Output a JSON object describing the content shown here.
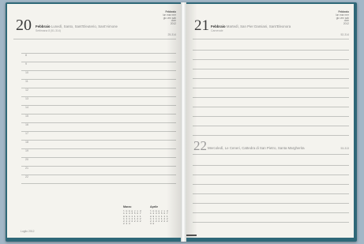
{
  "left_page": {
    "day_number": "20",
    "day_name": "Febbraio",
    "day_subtitle": "Lunedì, Santo, Sant'Eleuterio, Sant'Aimone",
    "day_line2": "Settimana 8 (51-314)",
    "mini_calendar": [
      "Febbraio",
      "lun mar mer",
      "gio ven sab",
      "dom",
      "2012"
    ],
    "corner_text": "25-314",
    "hours": [
      "8",
      "9",
      "10",
      "11",
      "12",
      "13",
      "14",
      "15",
      "16",
      "17",
      "18",
      "19",
      "20",
      "21",
      "22"
    ],
    "footer_text": "Luglio 2012",
    "cal1_head": "Marzo",
    "cal2_head": "Aprile",
    "cal1_body": "l m m g v s d\n1 2 3 4 5 6 7\n8 9 1 1 1 1 1\n1 1 1 1 1 2 2\n2 2 2 2 2 2 2\n2 3 3",
    "cal2_body": "l m m g v s d\n1 2 3 4 5 6 7\n8 9 1 1 1 1 1\n1 1 1 1 1 2 2\n2 2 2 2 2 2 2\n3 0"
  },
  "right_page": {
    "day_number": "21",
    "day_name": "Febbraio",
    "day_subtitle": "Martedì, San Pier Damiani, Sant'Eleonora",
    "day_line2": "Carnevale",
    "mini_calendar": [
      "Febbraio",
      "lun mar mer",
      "gio ven sab",
      "dom",
      "2012"
    ],
    "corner_text": "52-314",
    "day2_number": "22",
    "day2_subtitle": "Mercoledì, Le Ceneri, Cattedra di San Pietro, Santa Margherita",
    "day2_line2": "",
    "day2_corner": "53-313"
  }
}
